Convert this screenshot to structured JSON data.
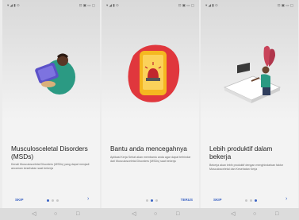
{
  "screens": [
    {
      "status_left": "▾ ◢ ▮ ⊙",
      "status_right": "⊡ ▣ ▭ ▢",
      "title": "Musculosceletal Disorders (MSDs)",
      "body": "Kenali Musculosceletal Disorders (MSDs) yang dapat menjadi ancaman kesehatan saat bekerja",
      "skip": "SKIP",
      "next_glyph": "›",
      "active_dot": 0
    },
    {
      "status_left": "▾ ◢ ▮ ⊙",
      "status_right": "⊡ ▣ ▭ ▢",
      "title": "Bantu anda mencegahnya",
      "body": "Aplikasi Kerja Sehat akan membantu anda agar dapat terhindar dari Musculosceletal Disorders (MSDs) saat bekerja",
      "done": "TERUS",
      "active_dot": 1
    },
    {
      "status_left": "▾ ◢ ▮ ⊙",
      "status_right": "⊡ ▣ ▭ ▢",
      "title": "Lebih produktif dalam bekerja",
      "body": "Bekerja akan lebih produktif dengan menghindarkan faktor Musculosceletal dan Kesehatan Kerja",
      "skip": "SKIP",
      "next_glyph": "›",
      "active_dot": 2
    }
  ],
  "navbar": {
    "back_glyph": "◁",
    "home_glyph": "○",
    "recent_glyph": "□"
  },
  "colors": {
    "accent": "#3b63c4",
    "illustration_red": "#e0373d",
    "illustration_yellow": "#f5b820",
    "illustration_green": "#2b9a83"
  }
}
